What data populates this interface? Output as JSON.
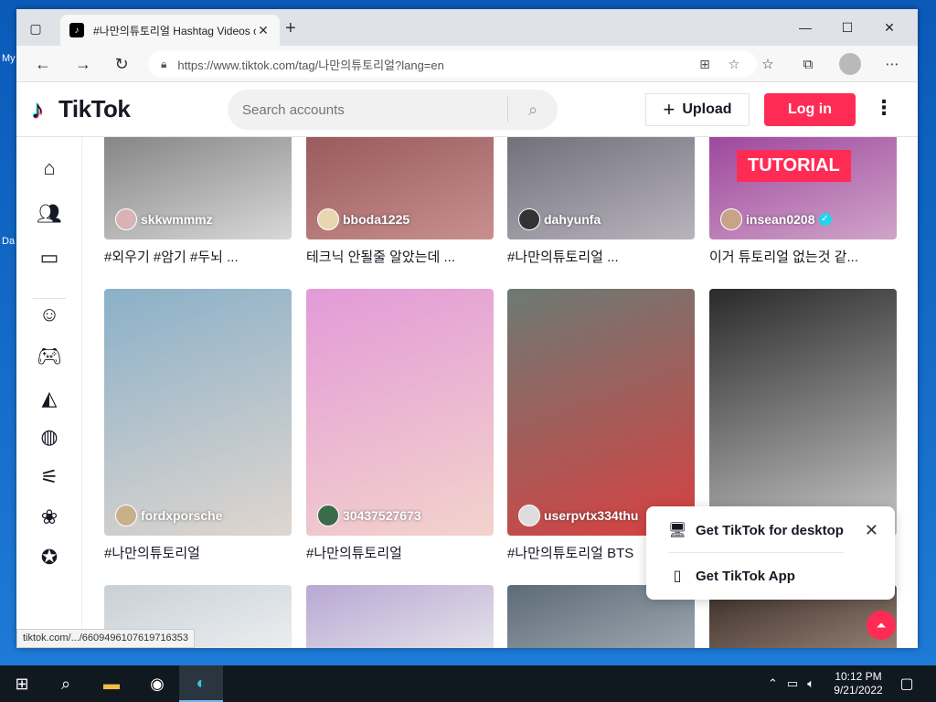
{
  "desktop": {
    "icon_labels": [
      "My",
      "Da"
    ]
  },
  "browser": {
    "tab_title": "#나만의튜토리얼 Hashtag Videos on TikTok",
    "url": "https://www.tiktok.com/tag/나만의튜토리얼?lang=en",
    "status_url": "tiktok.com/.../6609496107619716353"
  },
  "tiktok": {
    "logo_text": "TikTok",
    "search_placeholder": "Search accounts",
    "upload_label": "Upload",
    "login_label": "Log in",
    "videos": [
      {
        "user": "skkwmmmz",
        "caption": "#외우기 #암기 #두뇌 ...",
        "colors": [
          "#6b6b6b",
          "#d8d8d8"
        ],
        "avatar": "#d9b3b3"
      },
      {
        "user": "bboda1225",
        "caption": "테크닉 안될줄 알았는데 ...",
        "colors": [
          "#8a4a4a",
          "#c98f8f"
        ],
        "avatar": "#e8d6b0"
      },
      {
        "user": "dahyunfa",
        "caption": "#나만의튜토리얼 ...",
        "colors": [
          "#5a5a66",
          "#b8b4be"
        ],
        "avatar": "#333"
      },
      {
        "user": "insean0208",
        "caption": "이거 튜토리얼 없는것 같...",
        "colors": [
          "#8e2a8f",
          "#d0a4c9"
        ],
        "avatar": "#c9a28a",
        "verified": true,
        "overlay": "TUTORIAL"
      },
      {
        "user": "fordxporsche",
        "caption": "#나만의튜토리얼",
        "colors": [
          "#8ab0c8",
          "#e0d6cf"
        ],
        "avatar": "#c8b08a"
      },
      {
        "user": "30437527673",
        "caption": "#나만의튜토리얼",
        "colors": [
          "#e39ad8",
          "#f3d3cb"
        ],
        "avatar": "#3a6b4a"
      },
      {
        "user": "userpvtx334thu",
        "caption": "#나만의튜토리얼 BTS",
        "colors": [
          "#6c7a74",
          "#d84040"
        ],
        "avatar": "#ddd"
      },
      {
        "user": "",
        "caption": "",
        "colors": [
          "#2a2a2a",
          "#c8c8c8"
        ],
        "avatar": ""
      },
      {
        "user": "",
        "caption": "",
        "colors": [
          "#c8d0d6",
          "#eef0f2"
        ],
        "avatar": ""
      },
      {
        "user": "",
        "caption": "",
        "colors": [
          "#b9a7d4",
          "#e6e6ea"
        ],
        "avatar": ""
      },
      {
        "user": "",
        "caption": "",
        "colors": [
          "#5d6b78",
          "#a0aab2"
        ],
        "avatar": ""
      },
      {
        "user": "",
        "caption": "",
        "colors": [
          "#3a2e28",
          "#9a8478"
        ],
        "avatar": ""
      }
    ],
    "toast": {
      "desktop_label": "Get TikTok for desktop",
      "app_label": "Get TikTok App"
    }
  },
  "taskbar": {
    "time": "10:12 PM",
    "date": "9/21/2022"
  },
  "colors": {
    "accent": "#fe2c55",
    "taskbar": "#101820"
  }
}
